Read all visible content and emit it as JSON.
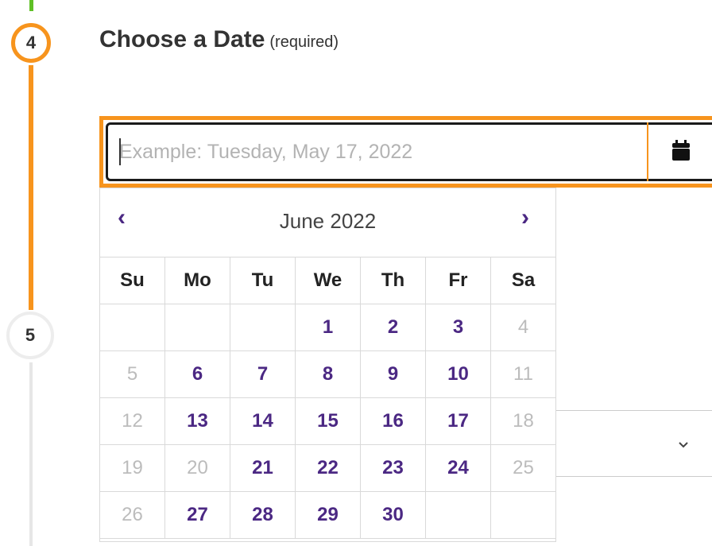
{
  "steps": {
    "step4": "4",
    "step5": "5"
  },
  "section": {
    "title": "Choose a Date",
    "required": "(required)"
  },
  "date_field": {
    "placeholder": "Example: Tuesday, May 17, 2022",
    "value": ""
  },
  "calendar": {
    "month": "June 2022",
    "prev": "‹",
    "next": "›",
    "weekdays": [
      "Su",
      "Mo",
      "Tu",
      "We",
      "Th",
      "Fr",
      "Sa"
    ],
    "weeks": [
      [
        {
          "d": "",
          "s": "empty"
        },
        {
          "d": "",
          "s": "empty"
        },
        {
          "d": "",
          "s": "empty"
        },
        {
          "d": "1",
          "s": "cur"
        },
        {
          "d": "2",
          "s": "cur"
        },
        {
          "d": "3",
          "s": "cur"
        },
        {
          "d": "4",
          "s": "dis"
        }
      ],
      [
        {
          "d": "5",
          "s": "dis"
        },
        {
          "d": "6",
          "s": "cur"
        },
        {
          "d": "7",
          "s": "cur"
        },
        {
          "d": "8",
          "s": "cur"
        },
        {
          "d": "9",
          "s": "cur"
        },
        {
          "d": "10",
          "s": "cur"
        },
        {
          "d": "11",
          "s": "dis"
        }
      ],
      [
        {
          "d": "12",
          "s": "dis"
        },
        {
          "d": "13",
          "s": "cur"
        },
        {
          "d": "14",
          "s": "cur"
        },
        {
          "d": "15",
          "s": "cur"
        },
        {
          "d": "16",
          "s": "cur"
        },
        {
          "d": "17",
          "s": "cur"
        },
        {
          "d": "18",
          "s": "dis"
        }
      ],
      [
        {
          "d": "19",
          "s": "dis"
        },
        {
          "d": "20",
          "s": "dis"
        },
        {
          "d": "21",
          "s": "cur"
        },
        {
          "d": "22",
          "s": "cur"
        },
        {
          "d": "23",
          "s": "cur"
        },
        {
          "d": "24",
          "s": "cur"
        },
        {
          "d": "25",
          "s": "dis"
        }
      ],
      [
        {
          "d": "26",
          "s": "dis"
        },
        {
          "d": "27",
          "s": "cur"
        },
        {
          "d": "28",
          "s": "cur"
        },
        {
          "d": "29",
          "s": "cur"
        },
        {
          "d": "30",
          "s": "cur"
        },
        {
          "d": "",
          "s": "empty"
        },
        {
          "d": "",
          "s": "empty"
        }
      ]
    ]
  },
  "icons": {
    "calendar": "calendar-icon",
    "select_chevron": "chevron-down-icon"
  },
  "colors": {
    "accent": "#f7941d",
    "done": "#5fc026",
    "available_day": "#4b2883",
    "disabled_day": "#bcbcbc"
  }
}
